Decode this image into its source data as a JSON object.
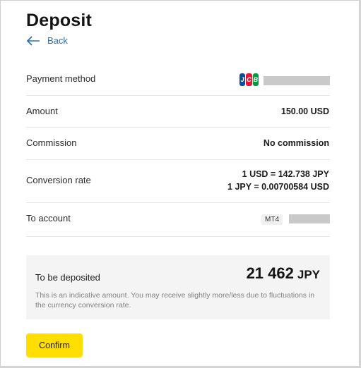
{
  "page": {
    "title": "Deposit",
    "back_label": "Back"
  },
  "details": {
    "payment_method": {
      "label": "Payment method",
      "icon": "jcb-card-icon",
      "brand_letters": [
        "J",
        "C",
        "B"
      ]
    },
    "amount": {
      "label": "Amount",
      "value": "150.00 USD"
    },
    "commission": {
      "label": "Commission",
      "value": "No commission"
    },
    "conversion_rate": {
      "label": "Conversion rate",
      "line1": "1 USD = 142.738 JPY",
      "line2": "1 JPY = 0.00700584 USD"
    },
    "to_account": {
      "label": "To account",
      "badge": "MT4"
    }
  },
  "summary": {
    "label": "To be deposited",
    "amount": "21 462",
    "currency": "JPY",
    "note": "This is an indicative amount. You may receive slightly more/less due to fluctuations in the currency conversion rate."
  },
  "actions": {
    "confirm_label": "Confirm"
  },
  "colors": {
    "accent_yellow": "#ffde02",
    "link_blue": "#2a6bb5",
    "summary_bg": "#f4f4f4",
    "redacted_gray": "#c9c9c9"
  }
}
